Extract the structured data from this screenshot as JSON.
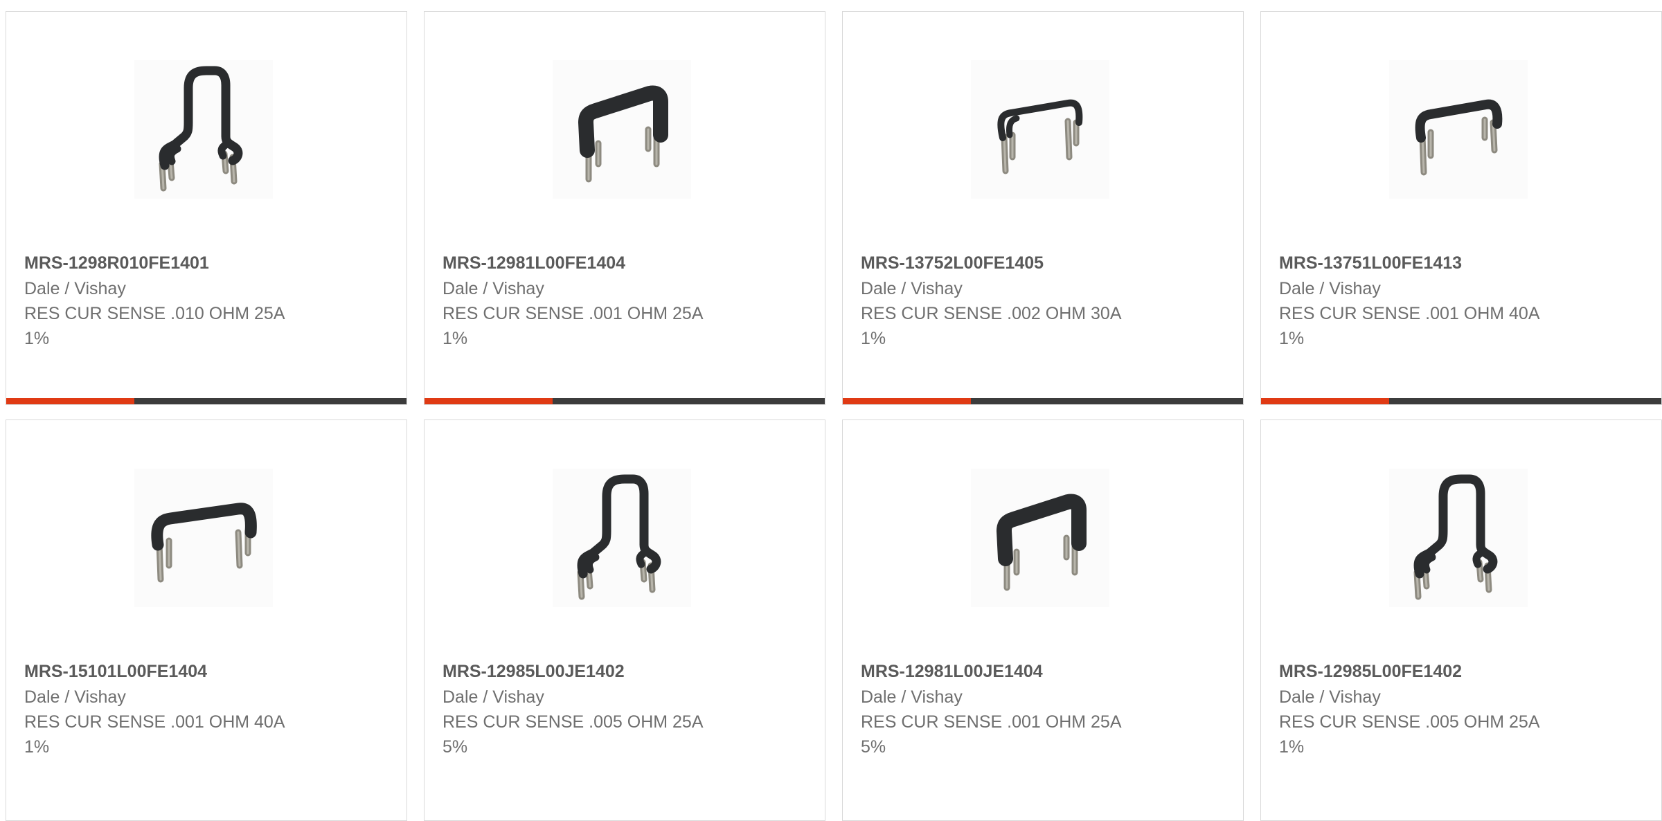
{
  "colors": {
    "accent": "#e03a14",
    "bar_track": "#3c3c3c",
    "card_border": "#d9d9d9",
    "part_text": "#5a5a5a",
    "body_text": "#6f6f6f",
    "resistor_body": "#2a2c2e",
    "lead_metal": "#8d8a80"
  },
  "products": [
    {
      "part_number": "MRS-1298R010FE1401",
      "manufacturer": "Dale / Vishay",
      "description": "RES CUR SENSE .010 OHM 25A",
      "tolerance": "1%",
      "image_icon": "tall-hairpin-resistor-icon",
      "progress": 0.32
    },
    {
      "part_number": "MRS-12981L00FE1404",
      "manufacturer": "Dale / Vishay",
      "description": "RES CUR SENSE .001 OHM 25A",
      "tolerance": "1%",
      "image_icon": "thick-bridge-resistor-icon",
      "progress": 0.32
    },
    {
      "part_number": "MRS-13752L00FE1405",
      "manufacturer": "Dale / Vishay",
      "description": "RES CUR SENSE .002 OHM 30A",
      "tolerance": "1%",
      "image_icon": "thin-bridge-resistor-icon",
      "progress": 0.32
    },
    {
      "part_number": "MRS-13751L00FE1413",
      "manufacturer": "Dale / Vishay",
      "description": "RES CUR SENSE .001 OHM 40A",
      "tolerance": "1%",
      "image_icon": "medium-bridge-resistor-icon",
      "progress": 0.32
    },
    {
      "part_number": "MRS-15101L00FE1404",
      "manufacturer": "Dale / Vishay",
      "description": "RES CUR SENSE .001 OHM 40A",
      "tolerance": "1%",
      "image_icon": "wide-bridge-resistor-icon"
    },
    {
      "part_number": "MRS-12985L00JE1402",
      "manufacturer": "Dale / Vishay",
      "description": "RES CUR SENSE .005 OHM 25A",
      "tolerance": "5%",
      "image_icon": "tall-hairpin-resistor-icon"
    },
    {
      "part_number": "MRS-12981L00JE1404",
      "manufacturer": "Dale / Vishay",
      "description": "RES CUR SENSE .001 OHM 25A",
      "tolerance": "5%",
      "image_icon": "thick-bridge-resistor-icon"
    },
    {
      "part_number": "MRS-12985L00FE1402",
      "manufacturer": "Dale / Vishay",
      "description": "RES CUR SENSE .005 OHM 25A",
      "tolerance": "1%",
      "image_icon": "tall-hairpin-resistor-icon"
    }
  ]
}
